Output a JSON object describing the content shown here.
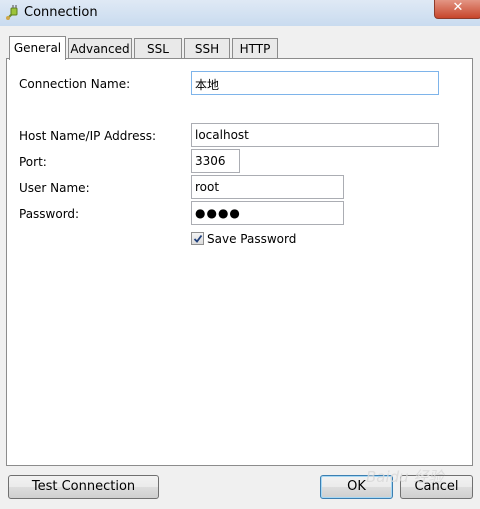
{
  "window": {
    "title": "Connection",
    "close_glyph": "✕"
  },
  "tabs": [
    {
      "label": "General",
      "active": true
    },
    {
      "label": "Advanced",
      "active": false
    },
    {
      "label": "SSL",
      "active": false
    },
    {
      "label": "SSH",
      "active": false
    },
    {
      "label": "HTTP",
      "active": false
    }
  ],
  "form": {
    "connection_name_label": "Connection Name:",
    "connection_name_value": "本地",
    "host_label": "Host Name/IP Address:",
    "host_value": "localhost",
    "port_label": "Port:",
    "port_value": "3306",
    "user_label": "User Name:",
    "user_value": "root",
    "password_label": "Password:",
    "password_value": "●●●●",
    "save_password_label": "Save Password",
    "save_password_checked": true
  },
  "buttons": {
    "test_connection": "Test Connection",
    "ok": "OK",
    "cancel": "Cancel"
  },
  "watermark": "Baidu 经验",
  "icons": {
    "app": "plug-connection-icon",
    "close": "close-icon",
    "check": "checkmark-icon"
  }
}
